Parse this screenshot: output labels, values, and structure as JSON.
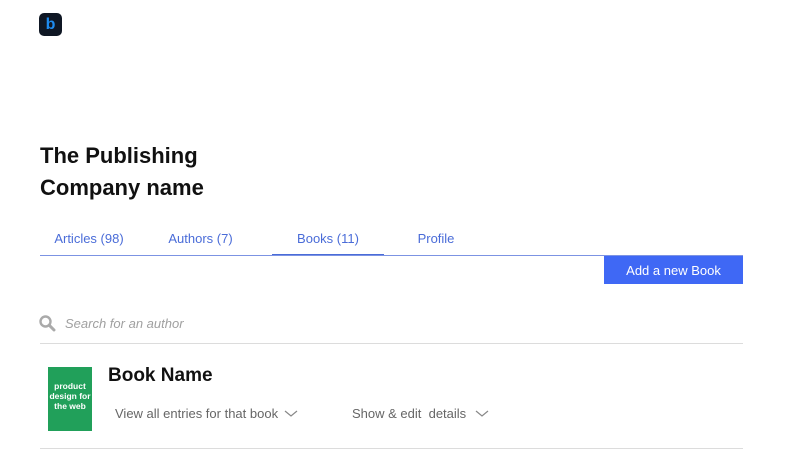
{
  "app": {
    "logo_letter": "b"
  },
  "header": {
    "company_title": "The Publishing Company name"
  },
  "tabs": [
    {
      "label": "Articles (98)",
      "active": false
    },
    {
      "label": "Authors (7)",
      "active": false
    },
    {
      "label": "Books (11)",
      "active": true
    },
    {
      "label": "Profile",
      "active": false
    }
  ],
  "actions": {
    "add_book_label": "Add a new Book"
  },
  "search": {
    "placeholder": "Search for an author",
    "value": ""
  },
  "books": [
    {
      "name": "Book Name",
      "cover_title": "product design for the web",
      "view_entries_label": "View all entries for that book",
      "show_details_label": "Show & edit  details"
    }
  ],
  "colors": {
    "accent": "#3f68f5",
    "tab_text": "#4a6cd8",
    "book_cover": "#21a05a",
    "logo_bg": "#0f1724",
    "logo_letter": "#1e8cf0"
  },
  "icons": {
    "search": "search-icon",
    "chevron": "chevron-down-icon",
    "logo": "logo-icon"
  }
}
